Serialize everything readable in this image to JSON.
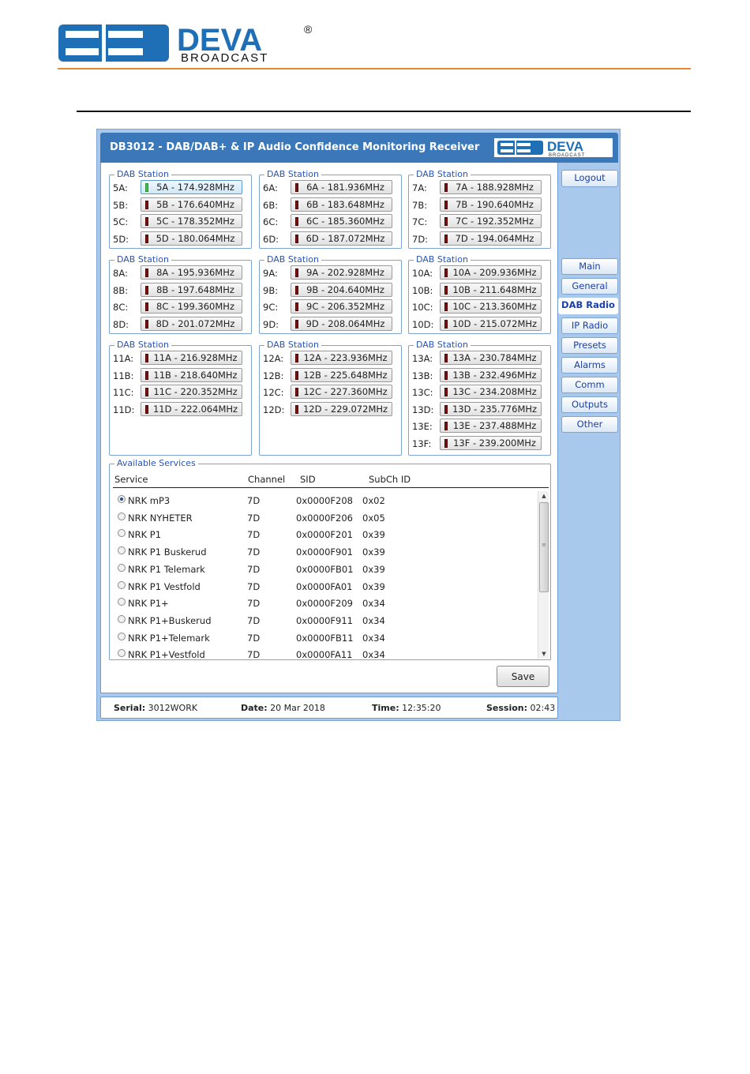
{
  "page": {
    "logo_text": "DEVA",
    "logo_sub": "BROADCAST",
    "logo_mark": "®"
  },
  "app": {
    "title": "DB3012 - DAB/DAB+ & IP Audio Confidence Monitoring Receiver",
    "logo_text": "DEVA",
    "logo_sub": "BROADCAST"
  },
  "dab_groups": [
    {
      "legend": "DAB Station",
      "stations": [
        {
          "label": "5A:",
          "value": "5A - 174.928MHz",
          "active": true
        },
        {
          "label": "5B:",
          "value": "5B - 176.640MHz"
        },
        {
          "label": "5C:",
          "value": "5C - 178.352MHz"
        },
        {
          "label": "5D:",
          "value": "5D - 180.064MHz"
        }
      ]
    },
    {
      "legend": "DAB Station",
      "stations": [
        {
          "label": "6A:",
          "value": "6A - 181.936MHz"
        },
        {
          "label": "6B:",
          "value": "6B - 183.648MHz"
        },
        {
          "label": "6C:",
          "value": "6C - 185.360MHz"
        },
        {
          "label": "6D:",
          "value": "6D - 187.072MHz"
        }
      ]
    },
    {
      "legend": "DAB Station",
      "stations": [
        {
          "label": "7A:",
          "value": "7A - 188.928MHz"
        },
        {
          "label": "7B:",
          "value": "7B - 190.640MHz"
        },
        {
          "label": "7C:",
          "value": "7C - 192.352MHz"
        },
        {
          "label": "7D:",
          "value": "7D - 194.064MHz"
        }
      ]
    },
    {
      "legend": "DAB Station",
      "stations": [
        {
          "label": "8A:",
          "value": "8A - 195.936MHz"
        },
        {
          "label": "8B:",
          "value": "8B - 197.648MHz"
        },
        {
          "label": "8C:",
          "value": "8C - 199.360MHz"
        },
        {
          "label": "8D:",
          "value": "8D - 201.072MHz"
        }
      ]
    },
    {
      "legend": "DAB Station",
      "stations": [
        {
          "label": "9A:",
          "value": "9A - 202.928MHz"
        },
        {
          "label": "9B:",
          "value": "9B - 204.640MHz"
        },
        {
          "label": "9C:",
          "value": "9C - 206.352MHz"
        },
        {
          "label": "9D:",
          "value": "9D - 208.064MHz"
        }
      ]
    },
    {
      "legend": "DAB Station",
      "stations": [
        {
          "label": "10A:",
          "value": "10A - 209.936MHz"
        },
        {
          "label": "10B:",
          "value": "10B - 211.648MHz"
        },
        {
          "label": "10C:",
          "value": "10C - 213.360MHz"
        },
        {
          "label": "10D:",
          "value": "10D - 215.072MHz"
        }
      ]
    },
    {
      "legend": "DAB Station",
      "stations": [
        {
          "label": "11A:",
          "value": "11A - 216.928MHz"
        },
        {
          "label": "11B:",
          "value": "11B - 218.640MHz"
        },
        {
          "label": "11C:",
          "value": "11C - 220.352MHz"
        },
        {
          "label": "11D:",
          "value": "11D - 222.064MHz"
        }
      ]
    },
    {
      "legend": "DAB Station",
      "stations": [
        {
          "label": "12A:",
          "value": "12A - 223.936MHz"
        },
        {
          "label": "12B:",
          "value": "12B - 225.648MHz"
        },
        {
          "label": "12C:",
          "value": "12C - 227.360MHz"
        },
        {
          "label": "12D:",
          "value": "12D - 229.072MHz"
        }
      ]
    },
    {
      "legend": "DAB Station",
      "stations": [
        {
          "label": "13A:",
          "value": "13A - 230.784MHz"
        },
        {
          "label": "13B:",
          "value": "13B - 232.496MHz"
        },
        {
          "label": "13C:",
          "value": "13C - 234.208MHz"
        },
        {
          "label": "13D:",
          "value": "13D - 235.776MHz"
        },
        {
          "label": "13E:",
          "value": "13E - 237.488MHz"
        },
        {
          "label": "13F:",
          "value": "13F - 239.200MHz"
        }
      ]
    }
  ],
  "services": {
    "legend": "Available Services",
    "headers": {
      "service": "Service",
      "channel": "Channel",
      "sid": "SID",
      "subch": "SubCh ID"
    },
    "rows": [
      {
        "name": "NRK mP3",
        "channel": "7D",
        "sid": "0x0000F208",
        "subch": "0x02",
        "selected": true
      },
      {
        "name": "NRK NYHETER",
        "channel": "7D",
        "sid": "0x0000F206",
        "subch": "0x05"
      },
      {
        "name": "NRK P1",
        "channel": "7D",
        "sid": "0x0000F201",
        "subch": "0x39"
      },
      {
        "name": "NRK P1 Buskerud",
        "channel": "7D",
        "sid": "0x0000F901",
        "subch": "0x39"
      },
      {
        "name": "NRK P1 Telemark",
        "channel": "7D",
        "sid": "0x0000FB01",
        "subch": "0x39"
      },
      {
        "name": "NRK P1 Vestfold",
        "channel": "7D",
        "sid": "0x0000FA01",
        "subch": "0x39"
      },
      {
        "name": "NRK P1+",
        "channel": "7D",
        "sid": "0x0000F209",
        "subch": "0x34"
      },
      {
        "name": "NRK P1+Buskerud",
        "channel": "7D",
        "sid": "0x0000F911",
        "subch": "0x34"
      },
      {
        "name": "NRK P1+Telemark",
        "channel": "7D",
        "sid": "0x0000FB11",
        "subch": "0x34"
      },
      {
        "name": "NRK P1+Vestfold",
        "channel": "7D",
        "sid": "0x0000FA11",
        "subch": "0x34"
      }
    ],
    "scroll_up_glyph": "▲",
    "scroll_down_glyph": "▼",
    "grip_glyph": "≡"
  },
  "save_label": "Save",
  "nav": {
    "logout": "Logout",
    "items": [
      {
        "label": "Main"
      },
      {
        "label": "General"
      },
      {
        "label": "DAB Radio",
        "active": true
      },
      {
        "label": "IP Radio"
      },
      {
        "label": "Presets"
      },
      {
        "label": "Alarms"
      },
      {
        "label": "Comm"
      },
      {
        "label": "Outputs"
      },
      {
        "label": "Other"
      }
    ]
  },
  "status": {
    "serial_label": "Serial:",
    "serial": "3012WORK",
    "date_label": "Date:",
    "date": "20 Mar 2018",
    "time_label": "Time:",
    "time": "12:35:20",
    "session_label": "Session:",
    "session": "02:43"
  },
  "colors": {
    "brand_blue": "#1e6fb6",
    "title_bar": "#3a78ba",
    "frame": "#a9c9ec",
    "accent_orange": "#e8892f",
    "led_off": "#7a1010",
    "led_on": "#46c24b"
  }
}
